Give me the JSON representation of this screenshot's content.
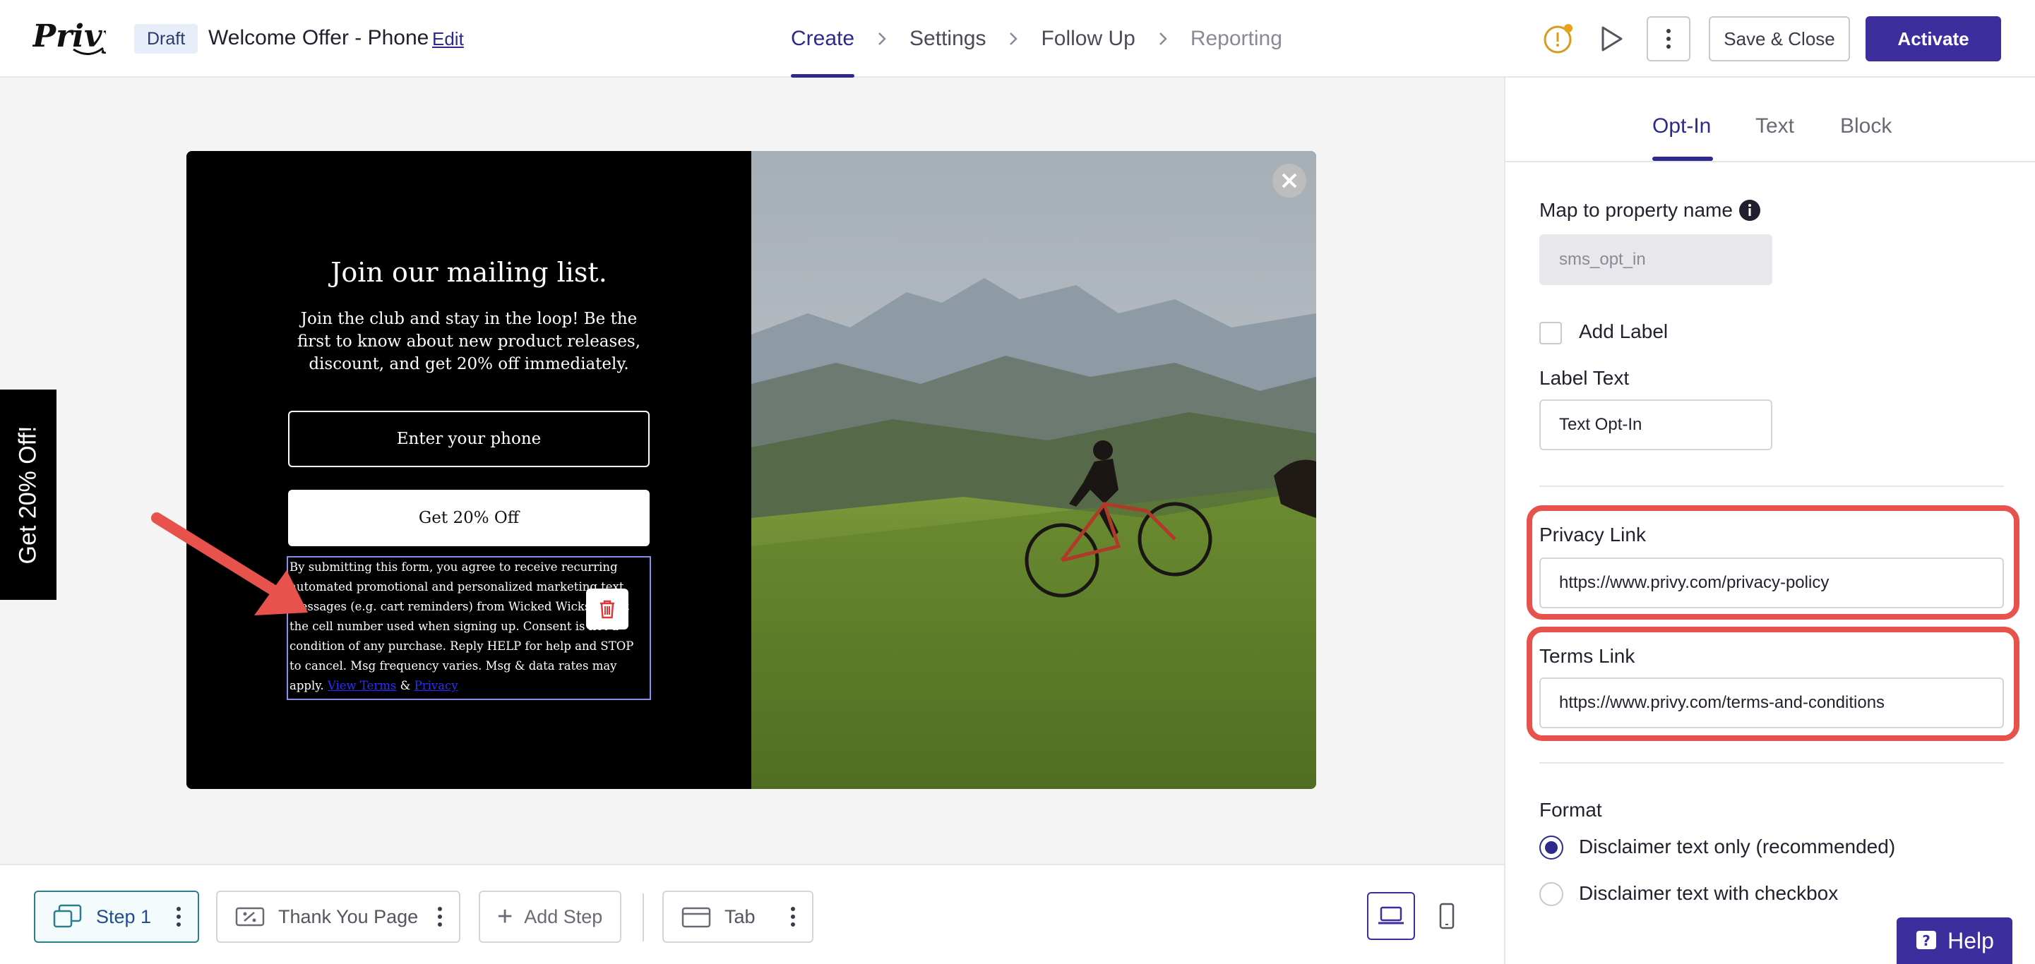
{
  "header": {
    "logo_text": "Privy",
    "status_badge": "Draft",
    "campaign_title": "Welcome Offer - Phone",
    "edit_label": "Edit",
    "steps": [
      {
        "label": "Create",
        "state": "active"
      },
      {
        "label": "Settings",
        "state": "normal"
      },
      {
        "label": "Follow Up",
        "state": "normal"
      },
      {
        "label": "Reporting",
        "state": "disabled"
      }
    ],
    "save_close_label": "Save & Close",
    "activate_label": "Activate"
  },
  "canvas": {
    "side_tab_text": "Get 20% Off!",
    "popup": {
      "heading": "Join our mailing list.",
      "body": "Join the club and stay in the loop! Be the first to know about new product releases, discount, and get 20% off immediately.",
      "phone_placeholder": "Enter your phone",
      "cta_label": "Get 20% Off",
      "disclaimer": "By submitting this form, you agree to receive recurring automated promotional and personalized marketing text messages (e.g. cart reminders) from Wicked Wicks Co. at the cell number used when signing up. Consent is not a condition of any purchase. Reply HELP for help and STOP to cancel. Msg frequency varies. Msg & data rates may apply.",
      "terms_link": "View Terms",
      "amp": "&",
      "privacy_link": "Privacy"
    }
  },
  "bottom_bar": {
    "steps": [
      {
        "label": "Step 1",
        "icon": "popup-icon",
        "active": true
      },
      {
        "label": "Thank You Page",
        "icon": "coupon-icon",
        "active": false
      }
    ],
    "add_step_label": "Add Step",
    "tab_label": "Tab",
    "view_modes": [
      "desktop",
      "mobile"
    ]
  },
  "panel": {
    "tabs": [
      {
        "label": "Opt-In",
        "active": true
      },
      {
        "label": "Text",
        "active": false
      },
      {
        "label": "Block",
        "active": false
      }
    ],
    "property_label": "Map to property name",
    "property_value": "sms_opt_in",
    "add_label_text": "Add Label",
    "label_text_label": "Label Text",
    "label_text_value": "Text Opt-In",
    "privacy_link_label": "Privacy Link",
    "privacy_link_value": "https://www.privy.com/privacy-policy",
    "terms_link_label": "Terms Link",
    "terms_link_value": "https://www.privy.com/terms-and-conditions",
    "format_label": "Format",
    "format_options": [
      {
        "label": "Disclaimer text only (recommended)",
        "selected": true
      },
      {
        "label": "Disclaimer text with checkbox",
        "selected": false
      }
    ],
    "highlight_color": "#e8524d"
  },
  "help_label": "Help",
  "colors": {
    "accent": "#3d2e9e",
    "nav_active": "#2e2a8c"
  }
}
